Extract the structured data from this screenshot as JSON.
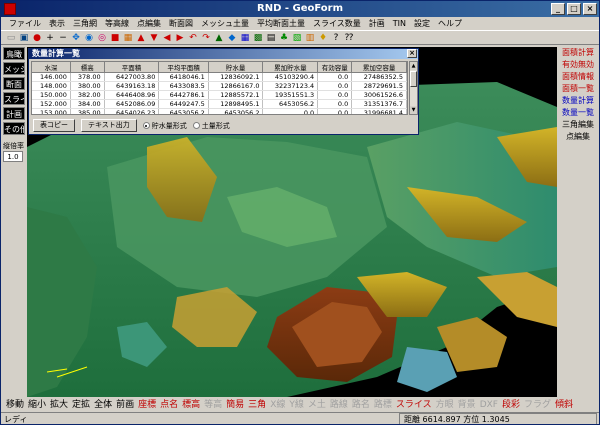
{
  "window": {
    "title": "RND - GeoForm"
  },
  "menu": [
    "ファイル",
    "表示",
    "三角網",
    "等高線",
    "点編集",
    "断面図",
    "メッシュ土量",
    "平均断面土量",
    "スライス数量",
    "計画",
    "TIN",
    "設定",
    "ヘルプ"
  ],
  "left_panel": {
    "buttons": [
      "鳥瞰",
      "メッシュ",
      "断面",
      "スライス",
      "計画",
      "その他"
    ],
    "scale_label": "縦倍率",
    "scale_value": "1.0"
  },
  "right_panel": {
    "buttons": [
      {
        "label": "面積計算",
        "color": "#c00000"
      },
      {
        "label": "有効無効",
        "color": "#c00000"
      },
      {
        "label": "面積情報",
        "color": "#c00000"
      },
      {
        "label": "面積一覧",
        "color": "#c00000"
      },
      {
        "label": "数量計算",
        "color": "#0000c0"
      },
      {
        "label": "数量一覧",
        "color": "#0000c0"
      },
      {
        "label": "三角編集",
        "color": "#000000"
      },
      {
        "label": "点編集",
        "color": "#000000"
      }
    ]
  },
  "dialog": {
    "title": "数量計算一覧",
    "columns": [
      "水深",
      "標高",
      "平面積",
      "平均平面積",
      "貯水量",
      "累加貯水量",
      "有効容量",
      "累加空容量"
    ],
    "rows": [
      [
        "146.000",
        "378.00",
        "6427003.80",
        "6418046.1",
        "12836092.1",
        "45103290.4",
        "0.0",
        "27486352.5"
      ],
      [
        "148.000",
        "380.00",
        "6439163.18",
        "6433083.5",
        "12866167.0",
        "32237123.4",
        "0.0",
        "28729691.5"
      ],
      [
        "150.000",
        "382.00",
        "6446408.96",
        "6442786.1",
        "12885572.1",
        "19351551.3",
        "0.0",
        "30061526.6"
      ],
      [
        "152.000",
        "384.00",
        "6452086.09",
        "6449247.5",
        "12898495.1",
        "6453056.2",
        "0.0",
        "31351376.7"
      ],
      [
        "153.000",
        "385.00",
        "6454026.23",
        "6453056.2",
        "6453056.2",
        "0.0",
        "0.0",
        "31996681.4"
      ]
    ],
    "copy_button": "表コピー",
    "text_button": "テキスト出力",
    "radio_storage": "貯水量形式",
    "radio_earth": "土量形式"
  },
  "bottom_bar": [
    {
      "label": "移動",
      "color": "#000000"
    },
    {
      "label": "縮小",
      "color": "#000000"
    },
    {
      "label": "拡大",
      "color": "#000000"
    },
    {
      "label": "定拡",
      "color": "#000000"
    },
    {
      "label": "全体",
      "color": "#000000"
    },
    {
      "label": "前画",
      "color": "#000000"
    },
    {
      "label": "座標",
      "color": "#c00000"
    },
    {
      "label": "点名",
      "color": "#c00000"
    },
    {
      "label": "標高",
      "color": "#c00000"
    },
    {
      "label": "等高",
      "color": "#a0a0a0"
    },
    {
      "label": "簡易",
      "color": "#c00000"
    },
    {
      "label": "三角",
      "color": "#c00000"
    },
    {
      "label": "X線",
      "color": "#a0a0a0"
    },
    {
      "label": "Y線",
      "color": "#a0a0a0"
    },
    {
      "label": "メ土",
      "color": "#a0a0a0"
    },
    {
      "label": "路線",
      "color": "#a0a0a0"
    },
    {
      "label": "路名",
      "color": "#a0a0a0"
    },
    {
      "label": "路標",
      "color": "#a0a0a0"
    },
    {
      "label": "スライス",
      "color": "#c00000"
    },
    {
      "label": "方眼",
      "color": "#a0a0a0"
    },
    {
      "label": "背景",
      "color": "#a0a0a0"
    },
    {
      "label": "DXF",
      "color": "#a0a0a0"
    },
    {
      "label": "段彩",
      "color": "#c00000"
    },
    {
      "label": "フラグ",
      "color": "#a0a0a0"
    },
    {
      "label": "傾斜",
      "color": "#c00000"
    }
  ],
  "status": {
    "left": "レディ",
    "right": "距離 6614.897 方位 1.3045"
  }
}
